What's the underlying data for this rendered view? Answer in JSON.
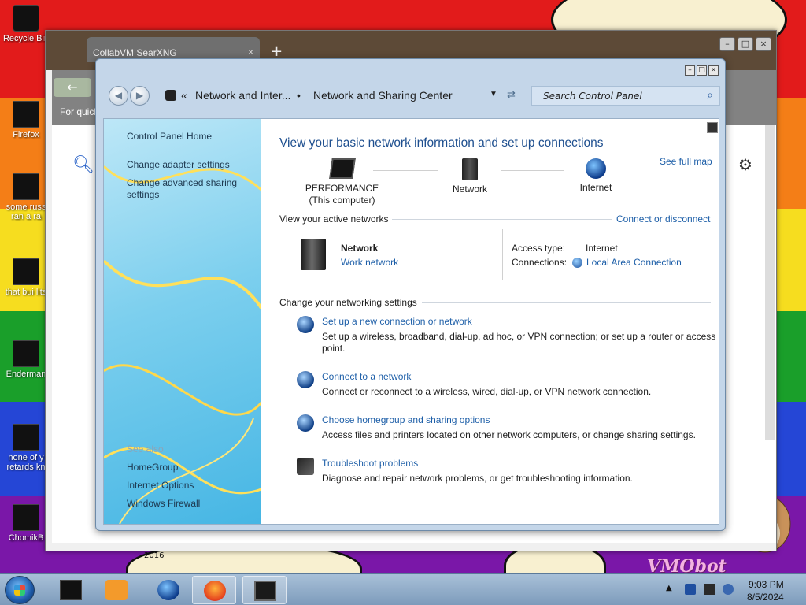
{
  "desktop": {
    "icons": [
      {
        "label": "Recycle Bin",
        "icon": "recycle-bin-icon"
      },
      {
        "label": "Firefox",
        "icon": "firefox-icon"
      },
      {
        "label": "some russ",
        "label2": "ran a ra",
        "icon": "file-icon"
      },
      {
        "label": "that bui lits",
        "icon": "file-icon"
      },
      {
        "label": "Enderman",
        "icon": "file-icon"
      },
      {
        "label": "none of y",
        "label2": "retards kn",
        "icon": "file-icon"
      },
      {
        "label": "ChomikB",
        "icon": "file-icon"
      }
    ],
    "wallpaper_text": "VMObot",
    "wallpaper_year": "2016"
  },
  "browser": {
    "tab_title": "CollabVM SearXNG",
    "tab_close": "×",
    "new_tab": "+",
    "quick_text": "For quick",
    "controls": {
      "min": "–",
      "max": "□",
      "close": "×"
    }
  },
  "control_panel": {
    "window_controls": {
      "min": "–",
      "max": "□",
      "close": "×"
    },
    "breadcrumb": {
      "chevrons": "«",
      "parent": "Network and Inter...",
      "separator": "•",
      "current": "Network and Sharing Center"
    },
    "search_placeholder": "Search Control Panel",
    "sidebar": {
      "links": [
        {
          "label": "Control Panel Home"
        },
        {
          "label": "Change adapter settings"
        },
        {
          "label": "Change advanced sharing settings"
        }
      ],
      "see_also_title": "See also",
      "see_also": [
        {
          "label": "HomeGroup"
        },
        {
          "label": "Internet Options"
        },
        {
          "label": "Windows Firewall"
        }
      ]
    },
    "main": {
      "heading": "View your basic network information and set up connections",
      "see_full_map": "See full map",
      "map": {
        "computer_name": "PERFORMANCE",
        "computer_sub": "(This computer)",
        "network": "Network",
        "internet": "Internet"
      },
      "active_networks_title": "View your active networks",
      "connect_or_disconnect": "Connect or disconnect",
      "active_network": {
        "name": "Network",
        "type": "Work network",
        "access_type_label": "Access type:",
        "access_type_value": "Internet",
        "connections_label": "Connections:",
        "connections_value": "Local Area Connection"
      },
      "change_settings_title": "Change your networking settings",
      "tasks": [
        {
          "link": "Set up a new connection or network",
          "desc": "Set up a wireless, broadband, dial-up, ad hoc, or VPN connection; or set up a router or access point.",
          "icon": "new-connection-icon"
        },
        {
          "link": "Connect to a network",
          "desc": "Connect or reconnect to a wireless, wired, dial-up, or VPN network connection.",
          "icon": "connect-network-icon"
        },
        {
          "link": "Choose homegroup and sharing options",
          "desc": "Access files and printers located on other network computers, or change sharing settings.",
          "icon": "homegroup-icon"
        },
        {
          "link": "Troubleshoot problems",
          "desc": "Diagnose and repair network problems, or get troubleshooting information.",
          "icon": "troubleshoot-icon"
        }
      ]
    }
  },
  "taskbar": {
    "clock_time": "9:03 PM",
    "clock_date": "8/5/2024",
    "tray_arrow": "▲"
  },
  "colors": {
    "link": "#1e5fa8",
    "heading": "#1e4f8f",
    "taskbar": "#8fadcb"
  }
}
